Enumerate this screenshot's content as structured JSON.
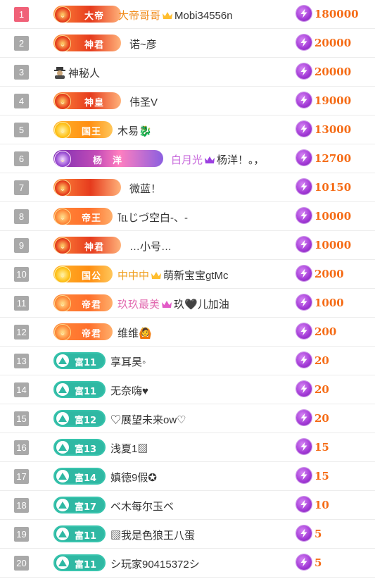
{
  "colors": {
    "amount": "#f56b15",
    "rank_top": "#f06178",
    "rank": "#a9a9a9",
    "fans_badge": "#2fb8a3"
  },
  "rows": [
    {
      "rank": "1",
      "badge": "大帝",
      "badge_style": "red",
      "name_prefix": "大帝哥哥",
      "name_prefix_color": "#f08a18",
      "crown": "gold",
      "name": "Mobi34556n",
      "amount": "180000"
    },
    {
      "rank": "2",
      "badge": "神君",
      "badge_style": "red",
      "name": "诺~彦",
      "amount": "20000"
    },
    {
      "rank": "3",
      "badge": "",
      "badge_style": "none",
      "avatar": "mystery-person-icon",
      "name": "神秘人",
      "amount": "20000"
    },
    {
      "rank": "4",
      "badge": "神皇",
      "badge_style": "red",
      "name": "伟圣V",
      "amount": "19000"
    },
    {
      "rank": "5",
      "badge": "国王",
      "badge_style": "gold",
      "name": "木易🐉",
      "amount": "13000"
    },
    {
      "rank": "6",
      "badge": "杨　洋",
      "badge_style": "purple",
      "name_prefix": "白月光",
      "name_prefix_color": "#c86bdc",
      "crown": "purple",
      "name": "杨洋！。，",
      "amount": "12700"
    },
    {
      "rank": "7",
      "badge": "",
      "badge_style": "red",
      "name": "微蓝！",
      "amount": "10150"
    },
    {
      "rank": "8",
      "badge": "帝王",
      "badge_style": "orange",
      "name": "℡じづ空白-、-",
      "amount": "10000"
    },
    {
      "rank": "9",
      "badge": "神君",
      "badge_style": "red",
      "name": "…小号…",
      "amount": "10000"
    },
    {
      "rank": "10",
      "badge": "国公",
      "badge_style": "gold",
      "name_prefix": "中中中",
      "name_prefix_color": "#f0a020",
      "crown": "gold",
      "name": "萌新宝宝gtMc",
      "amount": "2000"
    },
    {
      "rank": "11",
      "badge": "帝君",
      "badge_style": "orange",
      "name_prefix": "玖玖最美",
      "name_prefix_color": "#e26bb0",
      "crown": "pink",
      "name": "玖🖤儿加油",
      "amount": "1000"
    },
    {
      "rank": "12",
      "badge": "帝君",
      "badge_style": "orange",
      "name": "维维🙆",
      "amount": "200"
    },
    {
      "rank": "13",
      "badge": "富11",
      "badge_style": "teal",
      "name": "享耳昊◦",
      "amount": "20"
    },
    {
      "rank": "14",
      "badge": "富11",
      "badge_style": "teal",
      "name": "无奈嗨♥",
      "amount": "20"
    },
    {
      "rank": "15",
      "badge": "富12",
      "badge_style": "teal",
      "name": "♡展望未来ow♡",
      "amount": "20"
    },
    {
      "rank": "16",
      "badge": "富13",
      "badge_style": "teal",
      "name": "浅夏1▨",
      "amount": "15"
    },
    {
      "rank": "17",
      "badge": "富14",
      "badge_style": "teal",
      "name": "嫃徳9假✪",
      "amount": "15"
    },
    {
      "rank": "18",
      "badge": "富17",
      "badge_style": "teal",
      "name": "ベ木每尔玉ベ",
      "amount": "10"
    },
    {
      "rank": "19",
      "badge": "富11",
      "badge_style": "teal",
      "name": "▨我是色狼王八蛋",
      "amount": "5"
    },
    {
      "rank": "20",
      "badge": "富11",
      "badge_style": "teal",
      "name": "シ玩家90415372シ",
      "amount": "5"
    }
  ]
}
